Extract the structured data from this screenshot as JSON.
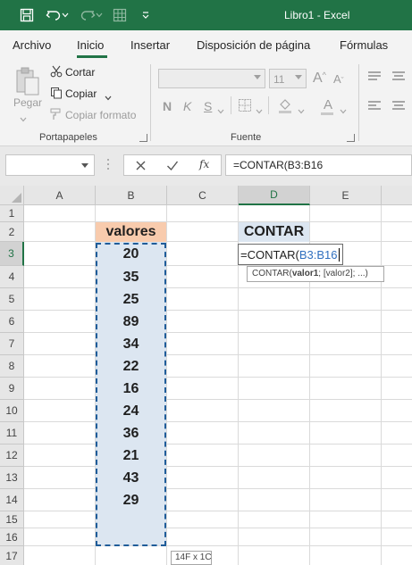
{
  "titlebar": {
    "title": "Libro1  -  Excel",
    "icons": [
      "save-icon",
      "undo-icon",
      "undo-dropdown-icon",
      "redo-icon",
      "redo-dropdown-icon",
      "grid-icon",
      "customize-dropdown-icon"
    ]
  },
  "tabs": [
    {
      "label": "Archivo"
    },
    {
      "label": "Inicio",
      "active": true
    },
    {
      "label": "Insertar"
    },
    {
      "label": "Disposición de página"
    },
    {
      "label": "Fórmulas"
    }
  ],
  "ribbon": {
    "clipboard": {
      "paste_label": "Pegar",
      "cut_label": "Cortar",
      "copy_label": "Copiar",
      "format_painter_label": "Copiar formato",
      "group_label": "Portapapeles"
    },
    "font": {
      "size_value": "11",
      "bold": "N",
      "italic": "K",
      "underline": "S",
      "font_color_letter": "A",
      "group_label": "Fuente"
    }
  },
  "formula_bar": {
    "name_box": "",
    "fx_label": "fx",
    "formula": "=CONTAR(B3:B16"
  },
  "grid": {
    "columns": [
      "A",
      "B",
      "C",
      "D",
      "E"
    ],
    "rows": [
      "1",
      "2",
      "3",
      "4",
      "5",
      "6",
      "7",
      "8",
      "9",
      "10",
      "11",
      "12",
      "13",
      "14",
      "15",
      "16",
      "17"
    ],
    "selected_column": "D",
    "selected_row": "3",
    "b2_header": "valores",
    "values": [
      "20",
      "35",
      "25",
      "89",
      "34",
      "22",
      "16",
      "24",
      "36",
      "21",
      "43",
      "29"
    ],
    "d2_header": "CONTAR",
    "edit_cell_prefix": "=CONTAR(",
    "edit_cell_ref": "B3:B16",
    "tooltip_func": "CONTAR(",
    "tooltip_arg1": "valor1",
    "tooltip_rest": "; [valor2]; ...)",
    "size_tip": "14F x 1C"
  },
  "colors": {
    "title_bar": "#217346",
    "header_fill": "#f8cbad",
    "data_fill": "#dce6f1",
    "reference": "#2f6fbf"
  }
}
